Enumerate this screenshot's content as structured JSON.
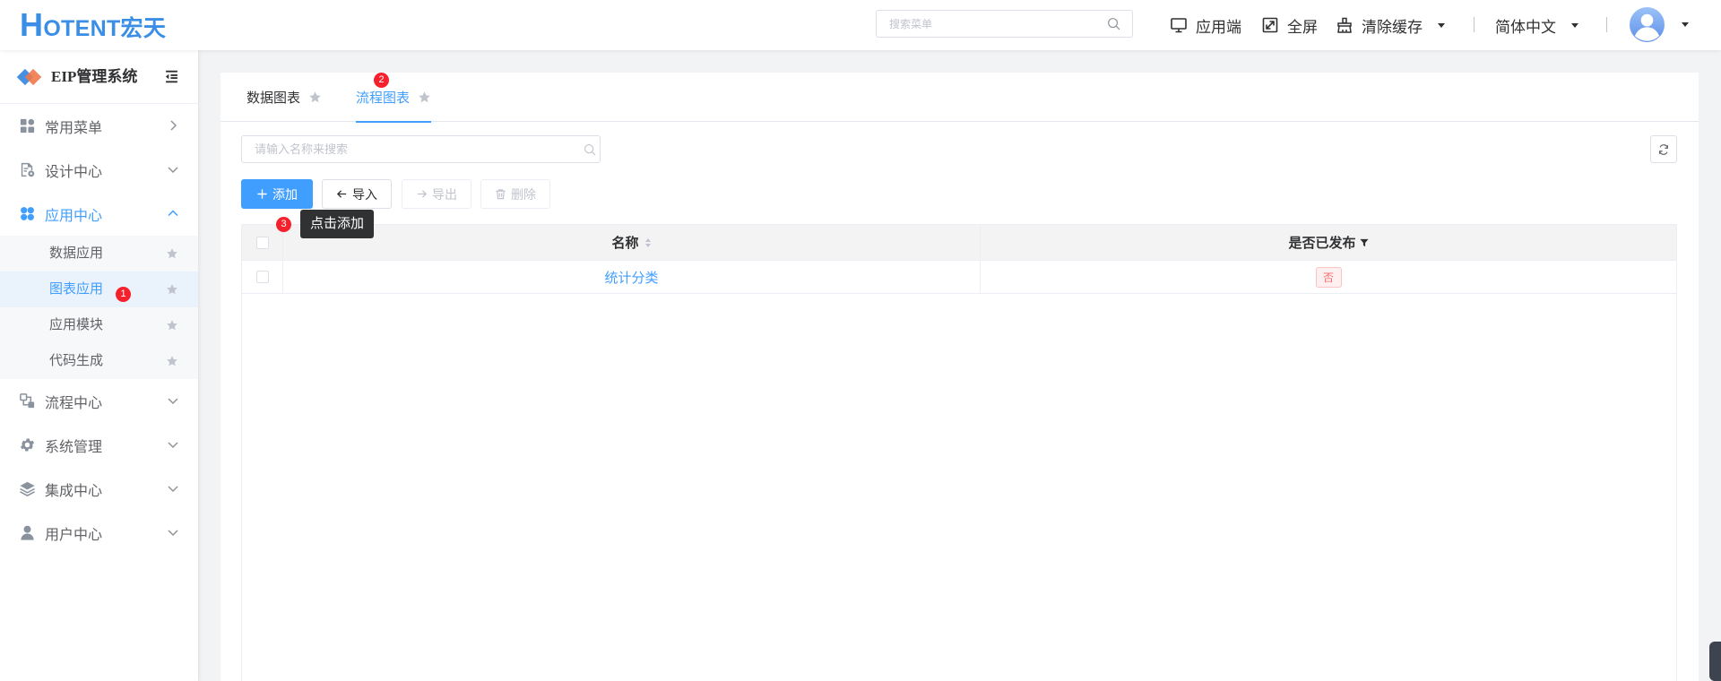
{
  "header": {
    "logo": "HOTENT宏天",
    "search_placeholder": "搜索菜单",
    "search_icon": "search-icon",
    "client_label": "应用端",
    "client_icon": "monitor-icon",
    "fullscreen_label": "全屏",
    "fullscreen_icon": "fullscreen-icon",
    "clear_cache_label": "清除缓存",
    "clear_cache_icon": "broom-icon",
    "language": "简体中文",
    "avatar_icon": "avatar-icon"
  },
  "sidebar": {
    "system_name": "EIP管理系统",
    "menu": [
      {
        "label": "常用菜单",
        "icon": "dashboard-icon",
        "chevron_icon": "chevron-right-icon"
      },
      {
        "label": "设计中心",
        "icon": "design-doc-icon",
        "chevron_icon": "chevron-down-icon"
      },
      {
        "label": "应用中心",
        "icon": "apps-icon",
        "chevron_icon": "chevron-up-icon",
        "active": true,
        "children": [
          {
            "label": "数据应用"
          },
          {
            "label": "图表应用",
            "selected": true
          },
          {
            "label": "应用模块"
          },
          {
            "label": "代码生成"
          }
        ]
      },
      {
        "label": "流程中心",
        "icon": "flow-icon",
        "chevron_icon": "chevron-down-icon"
      },
      {
        "label": "系统管理",
        "icon": "gear-icon",
        "chevron_icon": "chevron-down-icon"
      },
      {
        "label": "集成中心",
        "icon": "layers-icon",
        "chevron_icon": "chevron-down-icon"
      },
      {
        "label": "用户中心",
        "icon": "user-icon",
        "chevron_icon": "chevron-down-icon"
      }
    ]
  },
  "main": {
    "tabs": [
      {
        "label": "数据图表",
        "active": false
      },
      {
        "label": "流程图表",
        "active": true
      }
    ],
    "toolbar": {
      "search_placeholder": "请输入名称来搜索",
      "add_label": "添加",
      "import_label": "导入",
      "export_label": "导出",
      "delete_label": "删除"
    },
    "tooltip": "点击添加",
    "table": {
      "columns": [
        {
          "label": "名称",
          "icon": "sort-icon"
        },
        {
          "label": "是否已发布",
          "icon": "filter-icon"
        }
      ],
      "rows": [
        {
          "name": "统计分类",
          "published": "否"
        }
      ]
    }
  },
  "step_markers": [
    "1",
    "2",
    "3"
  ],
  "colors": {
    "primary": "#409eff",
    "logo": "#3a8ee6",
    "marker": "#f5222d",
    "danger_tag": "#f56c6c",
    "tooltip_bg": "#303133",
    "page_bg": "#f2f3f5"
  }
}
